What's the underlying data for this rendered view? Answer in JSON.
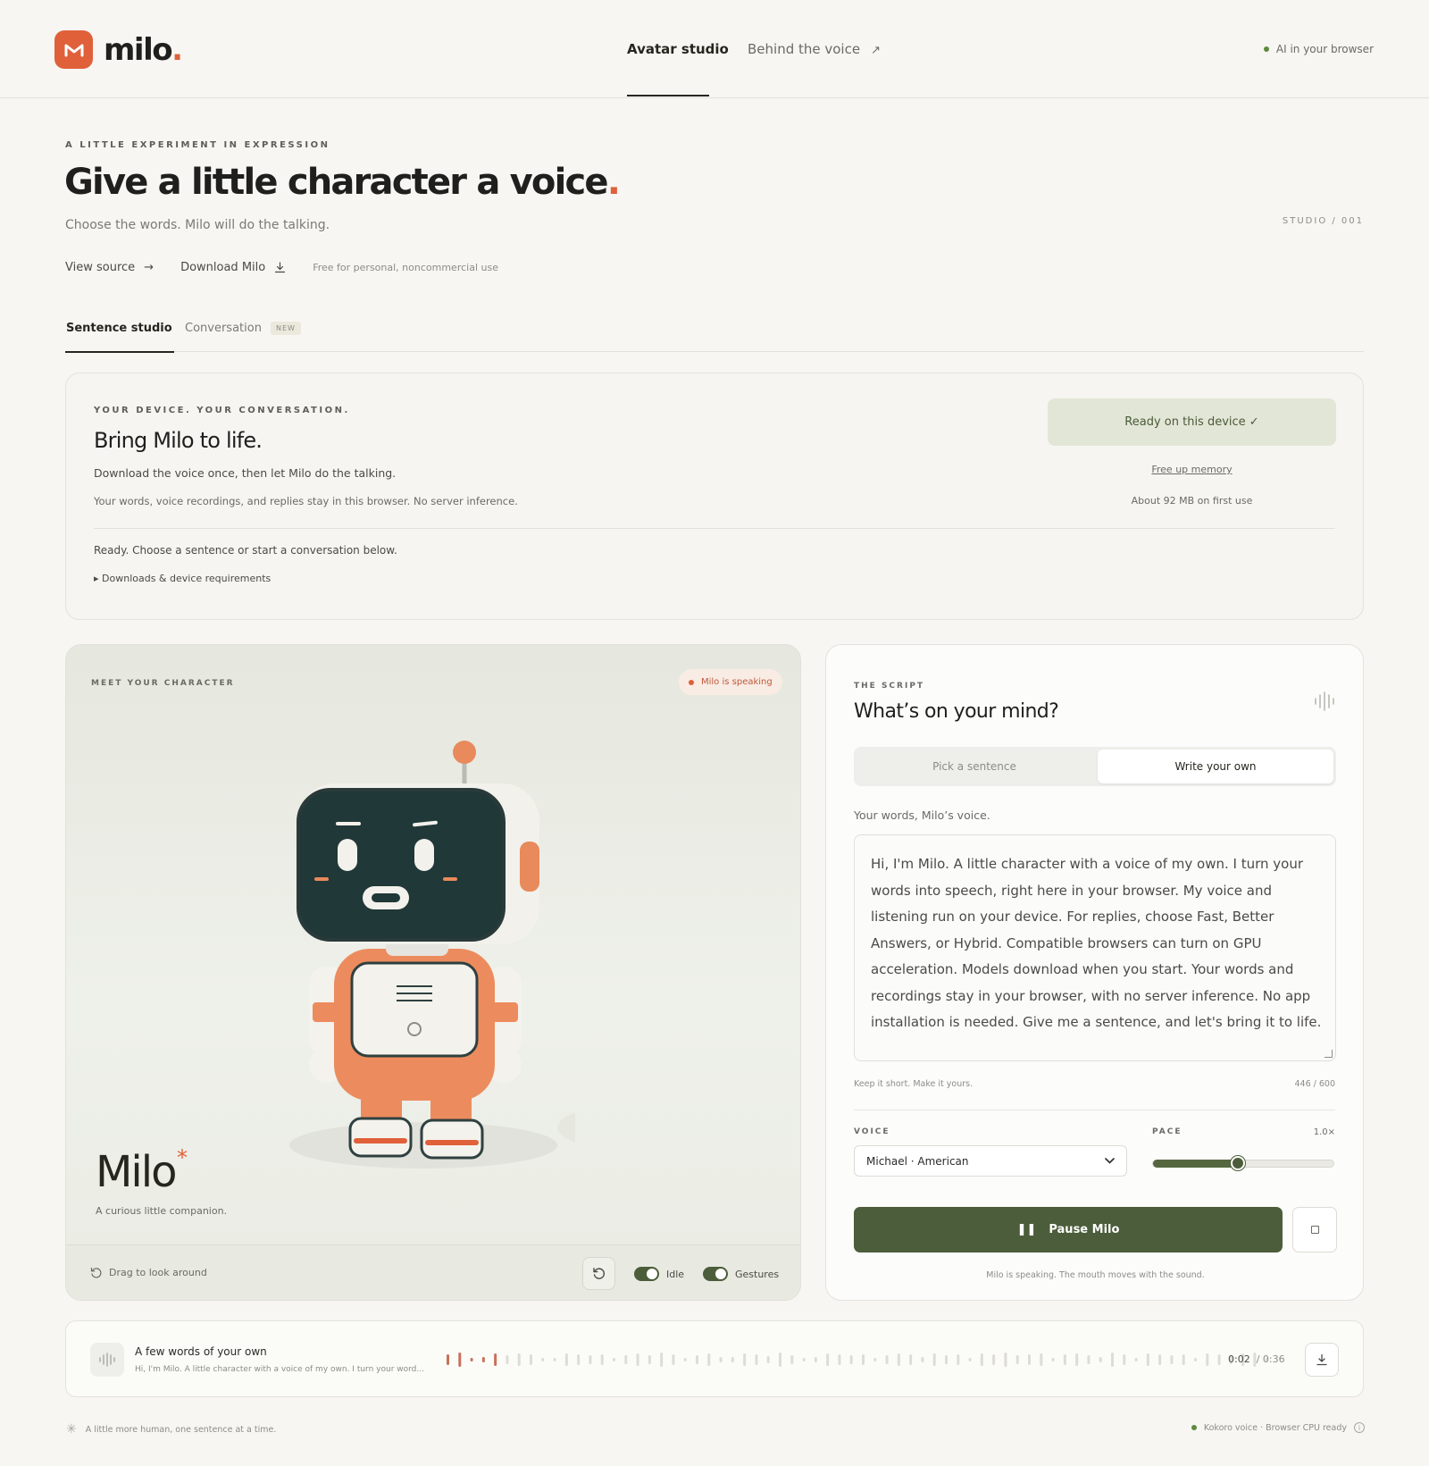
{
  "brand": {
    "name": "milo",
    "dot": ".",
    "accent": "#e0603a"
  },
  "nav": {
    "avatar_studio": "Avatar studio",
    "behind_voice": "Behind the voice",
    "ai_browser": "AI in your browser"
  },
  "hero": {
    "eyebrow": "A LITTLE EXPERIMENT IN EXPRESSION",
    "title": "Give a little character a voice",
    "title_dot": ".",
    "subtitle": "Choose the words. Milo will do the talking.",
    "studio_label": "STUDIO / 001",
    "view_source": "View source",
    "download": "Download Milo",
    "license_note": "Free for personal, noncommercial use"
  },
  "mode_tabs": {
    "sentence_studio": "Sentence studio",
    "conversation": "Conversation",
    "new_badge": "NEW"
  },
  "device_card": {
    "eyebrow": "YOUR DEVICE. YOUR CONVERSATION.",
    "title": "Bring Milo to life.",
    "line1": "Download the voice once, then let Milo do the talking.",
    "line2": "Your words, voice recordings, and replies stay in this browser. No server inference.",
    "ready_button": "Ready on this device ✓",
    "free_memory": "Free up memory",
    "size_note": "About 92 MB on first use",
    "status": "Ready. Choose a sentence or start a conversation below.",
    "details": "Downloads & device requirements"
  },
  "character": {
    "eyebrow": "MEET YOUR CHARACTER",
    "speaking_pill": "Milo is speaking",
    "name": "Milo",
    "star": "*",
    "subtitle": "A curious little companion.",
    "drag_hint": "Drag to look around",
    "toggle_idle": "Idle",
    "toggle_gestures": "Gestures",
    "idle_on": true,
    "gestures_on": true
  },
  "script": {
    "eyebrow": "THE SCRIPT",
    "title": "What’s on your mind?",
    "tab_pick": "Pick a sentence",
    "tab_write": "Write your own",
    "hint": "Your words, Milo’s voice.",
    "text": "Hi, I'm Milo. A little character with a voice of my own. I turn your words into speech, right here in your browser. My voice and listening run on your device. For replies, choose Fast, Better Answers, or Hybrid. Compatible browsers can turn on GPU acceleration. Models download when you start. Your words and recordings stay in your browser, with no server inference. No app installation is needed. Give me a sentence, and let's bring it to life.",
    "note": "Keep it short. Make it yours.",
    "count": "446 / 600",
    "voice_label": "VOICE",
    "voice_value": "Michael · American",
    "pace_label": "PACE",
    "pace_value": "1.0×",
    "pace_fraction": 0.47,
    "pause_button": "Pause Milo",
    "footnote": "Milo is speaking. The mouth moves with the sound."
  },
  "recording": {
    "title": "A few words of your own",
    "subtitle": "Hi, I'm Milo. A little character with a voice of my own. I turn your word...",
    "current_time": "0:02",
    "total_time": "/ 0:36",
    "progress": 0.06
  },
  "footer": {
    "tagline": "A little more human, one sentence at a time.",
    "status": "Kokoro voice · Browser CPU ready"
  }
}
